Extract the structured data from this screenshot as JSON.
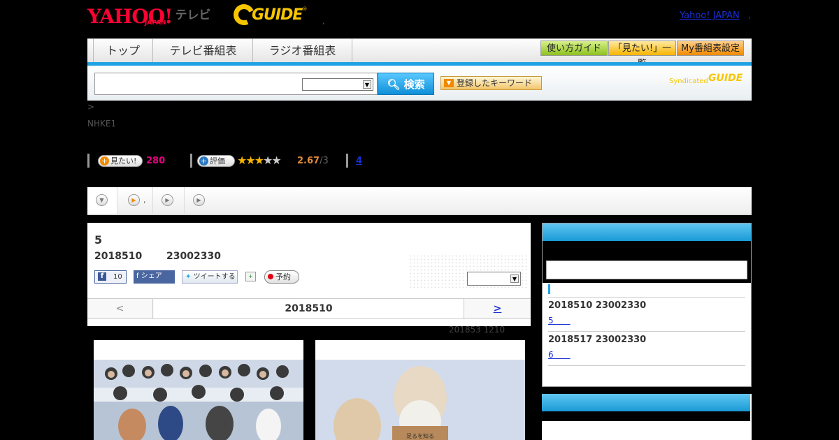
{
  "header": {
    "yahoo_logo": "YAHOO!",
    "japan_text": "JAPAN",
    "tv_text": "テレビ",
    "gguide_logo": "GUIDE",
    "tick_text": ",",
    "yahoo_japan_link": "Yahoo! JAPAN",
    "yahoo_japan_comma": ","
  },
  "nav": {
    "tabs": [
      "トップ",
      "テレビ番組表",
      "ラジオ番組表"
    ],
    "buttons": [
      "使い方ガイド",
      "「見たい!」一覧",
      "My番組表設定"
    ]
  },
  "search": {
    "query": "",
    "select_value": "",
    "button_label": "検索",
    "keyword_button": "登録したキーワード",
    "syndicated_text": "Syndicated",
    "syndicated_logo": "GUIDE"
  },
  "program_meta": {
    "breadcrumb": ">",
    "channel": "NHKE1",
    "want_label": "見たい!",
    "want_count": "280",
    "rate_label": "評価",
    "rating": 2.67,
    "score": "2.67",
    "score_max": "/3",
    "review_count": "4"
  },
  "subtabs": {
    "tab2_text": ","
  },
  "program": {
    "title": "5",
    "date": "2018510",
    "time": "23002330",
    "fb_like_count": "10",
    "fb_share": "シェア",
    "tweet": "ツイートする",
    "reserve": "予約",
    "select_value": "",
    "pager_prev": "<",
    "pager_current": "2018510",
    "pager_next": ">",
    "updated": "201853  1210"
  },
  "sidebar": {
    "search_value": "",
    "items": [
      {
        "date": "2018510  23002330",
        "link": "5　　"
      },
      {
        "date": "2018517  23002330",
        "link": "6　　"
      }
    ]
  },
  "colors": {
    "accent_blue": "#1ea2e4",
    "want_pink": "#e4007f",
    "star": "#f5b400",
    "gguide_yellow": "#f7c600"
  }
}
